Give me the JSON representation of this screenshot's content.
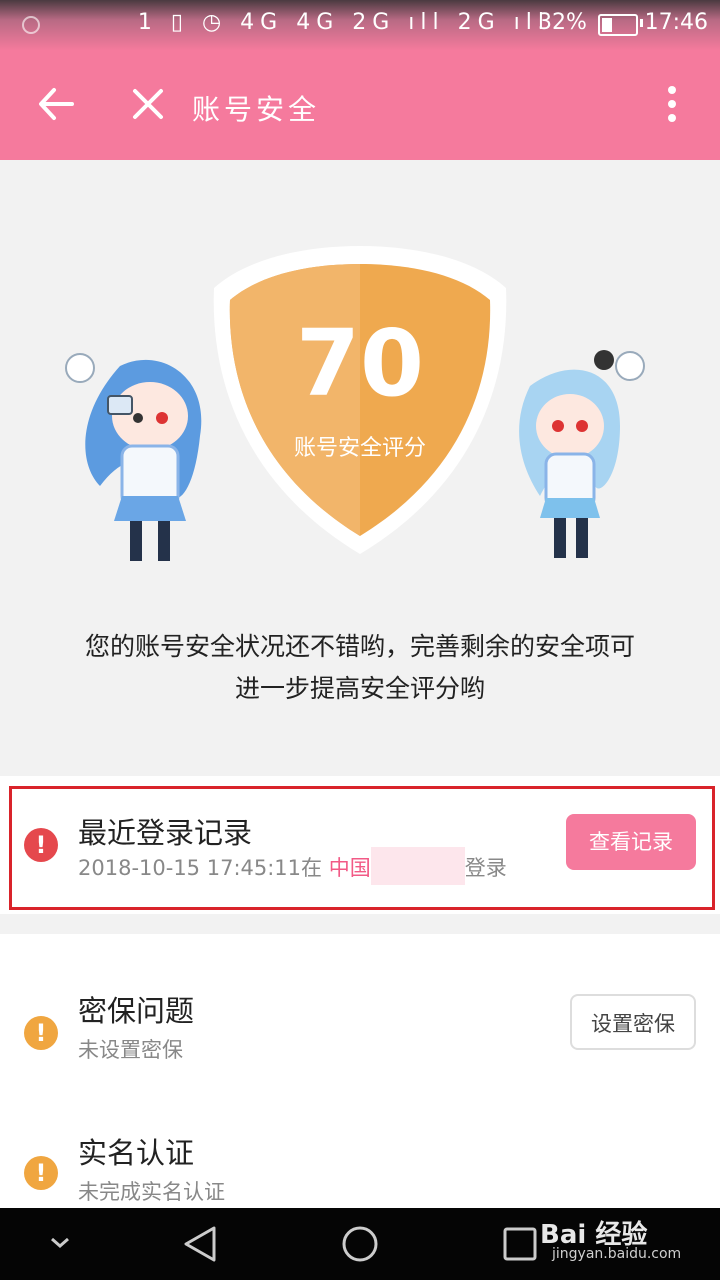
{
  "status": {
    "icons_text": "1 ▯ ◷ 4G 4G 2G ıll 2G ıll",
    "battery_percent": "32%",
    "battery_level": 0.32,
    "time": "17:46"
  },
  "appbar": {
    "title": "账号安全"
  },
  "hero": {
    "score": "70",
    "score_label": "账号安全评分",
    "description_line1": "您的账号安全状况还不错哟，完善剩余的安全项可",
    "description_line2": "进一步提高安全评分哟"
  },
  "rows": {
    "login": {
      "title": "最近登录记录",
      "date": "2018-10-15 17:45:11在",
      "location": "中国",
      "suffix": "登录",
      "button": "查看记录"
    },
    "security_question": {
      "title": "密保问题",
      "subtitle": "未设置密保",
      "button": "设置密保"
    },
    "realname": {
      "title": "实名认证",
      "subtitle": "未完成实名认证"
    }
  },
  "watermark": {
    "brand": "Bai 经验",
    "url": "jingyan.baidu.com"
  },
  "colors": {
    "accent": "#f57a9d",
    "danger": "#e5484d",
    "warning": "#f0a640",
    "shield": "#efa94f"
  }
}
